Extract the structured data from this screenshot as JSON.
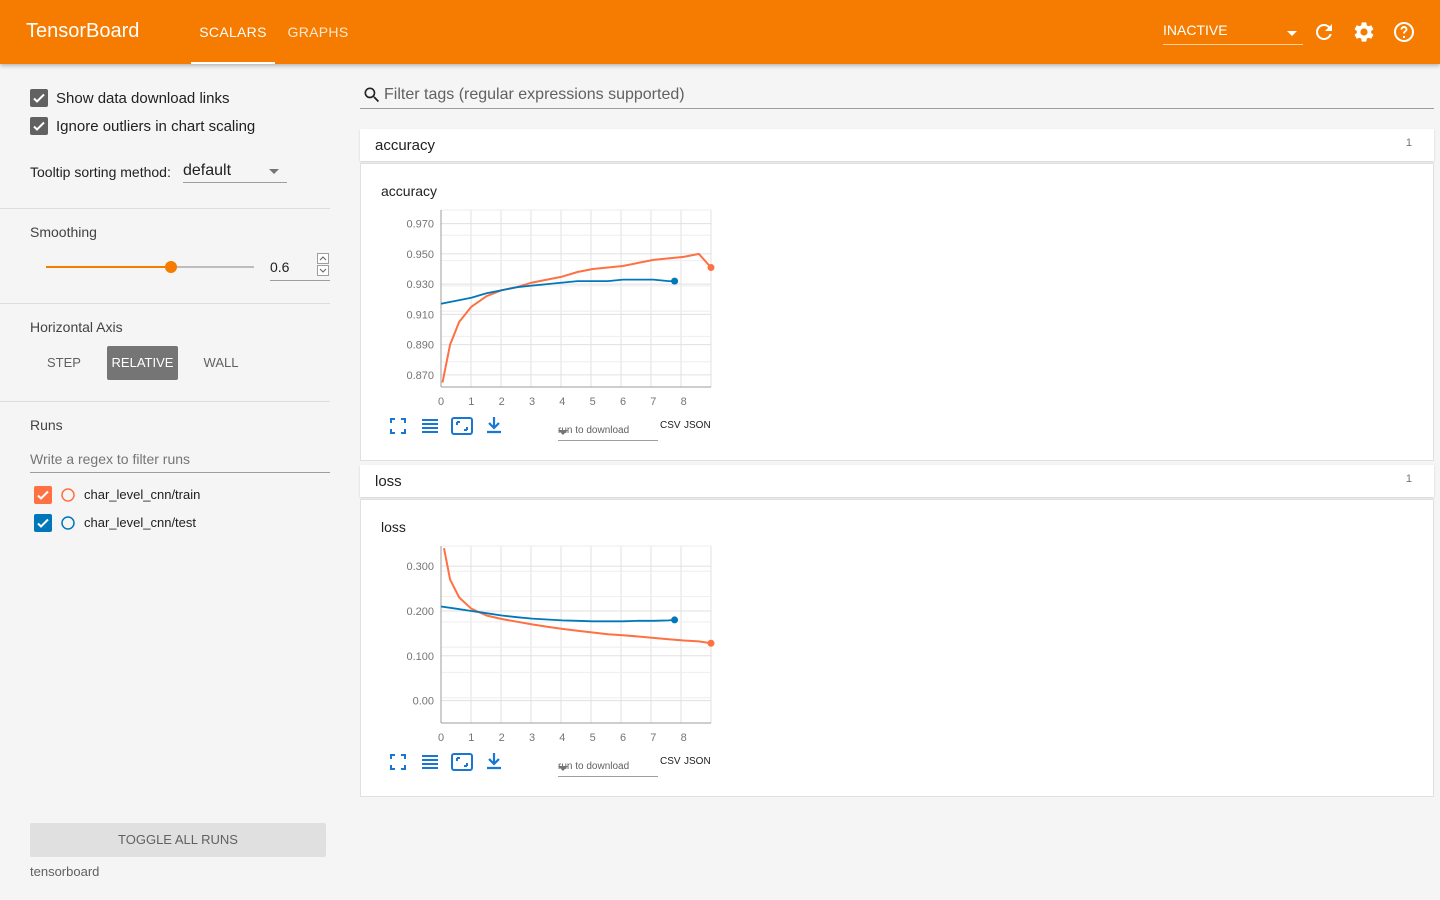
{
  "header": {
    "brand": "TensorBoard",
    "tabs": [
      {
        "label": "SCALARS",
        "active": true
      },
      {
        "label": "GRAPHS",
        "active": false
      }
    ],
    "status_select": "INACTIVE",
    "accent": "#f57c00"
  },
  "sidebar": {
    "show_download_links": {
      "label": "Show data download links",
      "checked": true
    },
    "ignore_outliers": {
      "label": "Ignore outliers in chart scaling",
      "checked": true
    },
    "tooltip": {
      "label": "Tooltip sorting method:",
      "value": "default"
    },
    "smoothing": {
      "title": "Smoothing",
      "value": "0.6",
      "fraction": 0.6
    },
    "horizontal_axis": {
      "title": "Horizontal Axis",
      "options": [
        "STEP",
        "RELATIVE",
        "WALL"
      ],
      "selected": "RELATIVE"
    },
    "runs": {
      "title": "Runs",
      "filter_placeholder": "Write a regex to filter runs",
      "items": [
        {
          "name": "char_level_cnn/train",
          "color": "#ff7043",
          "checked": true
        },
        {
          "name": "char_level_cnn/test",
          "color": "#0077bb",
          "checked": true
        }
      ]
    },
    "toggle_all": "TOGGLE ALL RUNS",
    "footer": "tensorboard"
  },
  "main": {
    "filter_placeholder": "Filter tags (regular expressions supported)",
    "categories": [
      {
        "name": "accuracy",
        "count": "1",
        "card_title": "accuracy",
        "download_select": "run to download",
        "csv": "CSV",
        "json": "JSON"
      },
      {
        "name": "loss",
        "count": "1",
        "card_title": "loss",
        "download_select": "run to download",
        "csv": "CSV",
        "json": "JSON"
      }
    ]
  },
  "chart_data": [
    {
      "type": "line",
      "title": "accuracy",
      "xlabel": "",
      "ylabel": "",
      "x_ticks": [
        "0",
        "1",
        "2",
        "3",
        "4",
        "5",
        "6",
        "7",
        "8"
      ],
      "y_ticks": [
        "0.970",
        "0.950",
        "0.930",
        "0.910",
        "0.890",
        "0.870"
      ],
      "xlim": [
        0,
        8.9
      ],
      "ylim": [
        0.862,
        0.979
      ],
      "grid": true,
      "series": [
        {
          "name": "char_level_cnn/train",
          "color": "#ff7043",
          "x": [
            0.05,
            0.3,
            0.6,
            1.0,
            1.5,
            2.0,
            2.5,
            3.0,
            3.5,
            4.0,
            4.5,
            5.0,
            5.5,
            6.0,
            6.5,
            7.0,
            7.5,
            8.0,
            8.5,
            8.9
          ],
          "y": [
            0.865,
            0.89,
            0.905,
            0.915,
            0.922,
            0.926,
            0.928,
            0.931,
            0.933,
            0.935,
            0.938,
            0.94,
            0.941,
            0.942,
            0.944,
            0.946,
            0.947,
            0.948,
            0.95,
            0.941
          ]
        },
        {
          "name": "char_level_cnn/test",
          "color": "#0077bb",
          "x": [
            0,
            0.5,
            1.0,
            1.5,
            2.0,
            2.5,
            3.0,
            3.5,
            4.0,
            4.5,
            5.0,
            5.5,
            6.0,
            6.5,
            7.0,
            7.5,
            7.7
          ],
          "y": [
            0.917,
            0.919,
            0.921,
            0.924,
            0.926,
            0.928,
            0.929,
            0.93,
            0.931,
            0.932,
            0.932,
            0.932,
            0.933,
            0.933,
            0.933,
            0.932,
            0.932
          ]
        }
      ]
    },
    {
      "type": "line",
      "title": "loss",
      "xlabel": "",
      "ylabel": "",
      "x_ticks": [
        "0",
        "1",
        "2",
        "3",
        "4",
        "5",
        "6",
        "7",
        "8"
      ],
      "y_ticks": [
        "0.300",
        "0.200",
        "0.100",
        "0.00"
      ],
      "xlim": [
        0,
        8.9
      ],
      "ylim": [
        -0.05,
        0.345
      ],
      "grid": true,
      "series": [
        {
          "name": "char_level_cnn/train",
          "color": "#ff7043",
          "x": [
            0.1,
            0.3,
            0.6,
            1.0,
            1.5,
            2.0,
            2.5,
            3.0,
            3.5,
            4.0,
            4.5,
            5.0,
            5.5,
            6.0,
            6.5,
            7.0,
            7.5,
            8.0,
            8.5,
            8.9
          ],
          "y": [
            0.34,
            0.27,
            0.23,
            0.205,
            0.19,
            0.182,
            0.176,
            0.17,
            0.165,
            0.16,
            0.156,
            0.152,
            0.148,
            0.146,
            0.143,
            0.14,
            0.137,
            0.134,
            0.132,
            0.128
          ]
        },
        {
          "name": "char_level_cnn/test",
          "color": "#0077bb",
          "x": [
            0,
            0.5,
            1.0,
            1.5,
            2.0,
            2.5,
            3.0,
            3.5,
            4.0,
            4.5,
            5.0,
            5.5,
            6.0,
            6.5,
            7.0,
            7.5,
            7.7
          ],
          "y": [
            0.21,
            0.205,
            0.2,
            0.195,
            0.19,
            0.186,
            0.183,
            0.181,
            0.179,
            0.178,
            0.177,
            0.177,
            0.177,
            0.178,
            0.178,
            0.179,
            0.18
          ]
        }
      ]
    }
  ]
}
